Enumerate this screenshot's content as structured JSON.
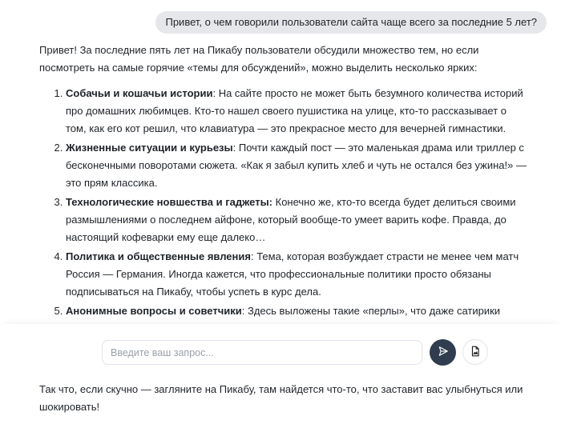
{
  "user_message": "Привет, о чем говорили пользователи сайта чаще всего за последние 5 лет?",
  "answer": {
    "intro": "Привет! За последние пять лет на Пикабу пользователи обсудили множество тем, но если посмотреть на самые горячие «темы для обсуждений», можно выделить несколько ярких:",
    "items": [
      {
        "title": "Собачьи и кошачьи истории",
        "text": ": На сайте просто не может быть безумного количества историй про домашних любимцев. Кто-то нашел своего пушистика на улице, кто-то рассказывает о том, как его кот решил, что клавиатура — это прекрасное место для вечерней гимнастики."
      },
      {
        "title": "Жизненные ситуации и курьезы",
        "text": ": Почти каждый пост — это маленькая драма или триллер с бесконечными поворотами сюжета. «Как я забыл купить хлеб и чуть не остался без ужина!» — это прям классика."
      },
      {
        "title": "Технологические новшества и гаджеты:",
        "text": " Конечно же, кто-то всегда будет делиться своими размышлениями о последнем айфоне, который вообще-то умеет варить кофе. Правда, до настоящий кофеварки ему еще далеко…"
      },
      {
        "title": "Политика и общественные явления",
        "text": ": Тема, которая возбуждает страсти не менее чем матч Россия — Германия. Иногда кажется, что профессиональные политики просто обязаны подписываться на Пикабу, чтобы успеть в курс дела."
      },
      {
        "title": "Анонимные вопросы и советчики",
        "text": ": Здесь выложены такие «перлы», что даже сатирики позавидовали бы. «Как вернуть любовь?», «Что делать с соседями?» — спроси, и на тебя посыплется тонна советов, начиная с «сделай массаж с оливковым маслом» и заканчивая «просто упадите в обморок»."
      }
    ],
    "outro": "Так что, если скучно — загляните на Пикабу, там найдется что-то, что заставит вас улыбнуться или шокировать!"
  },
  "composer": {
    "placeholder": "Введите ваш запрос...",
    "value": "",
    "send_icon": "send-icon",
    "attach_icon": "file-image-icon"
  }
}
